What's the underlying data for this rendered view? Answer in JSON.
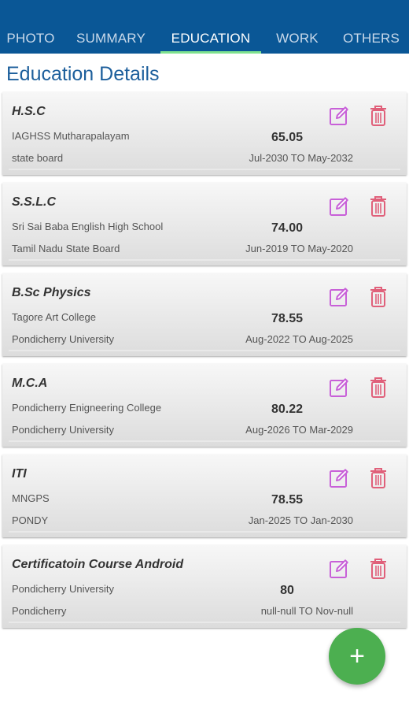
{
  "tabs": [
    {
      "label": "PHOTO",
      "active": false
    },
    {
      "label": "SUMMARY",
      "active": false
    },
    {
      "label": "EDUCATION",
      "active": true
    },
    {
      "label": "WORK",
      "active": false
    },
    {
      "label": "OTHERS",
      "active": false
    }
  ],
  "section_title": "Education Details",
  "colors": {
    "app_bar": "#0a5796",
    "tab_indicator": "#7fe28f",
    "title_text": "#1d5f9c",
    "action_icons": "#c860d8",
    "fab": "#4caf50"
  },
  "education": [
    {
      "title": "H.S.C",
      "institute": "IAGHSS Mutharapalayam",
      "board": "state board",
      "score": "65.05",
      "period": "Jul-2030 TO May-2032"
    },
    {
      "title": "S.S.L.C",
      "institute": "Sri Sai Baba English High School",
      "board": "Tamil Nadu State Board",
      "score": "74.00",
      "period": "Jun-2019 TO May-2020"
    },
    {
      "title": "B.Sc Physics",
      "institute": "Tagore Art College",
      "board": "Pondicherry University",
      "score": "78.55",
      "period": "Aug-2022 TO Aug-2025"
    },
    {
      "title": "M.C.A",
      "institute": "Pondicherry Enigneering College",
      "board": "Pondicherry University",
      "score": "80.22",
      "period": "Aug-2026 TO Mar-2029"
    },
    {
      "title": "ITI",
      "institute": "MNGPS",
      "board": "PONDY",
      "score": "78.55",
      "period": "Jan-2025 TO Jan-2030"
    },
    {
      "title": "Certificatoin Course Android",
      "institute": "Pondicherry University",
      "board": "Pondicherry",
      "score": "80",
      "period": "null-null TO Nov-null"
    }
  ],
  "icons": {
    "edit": "edit-icon",
    "delete": "trash-icon",
    "add": "plus-icon"
  },
  "fab_label": "+"
}
